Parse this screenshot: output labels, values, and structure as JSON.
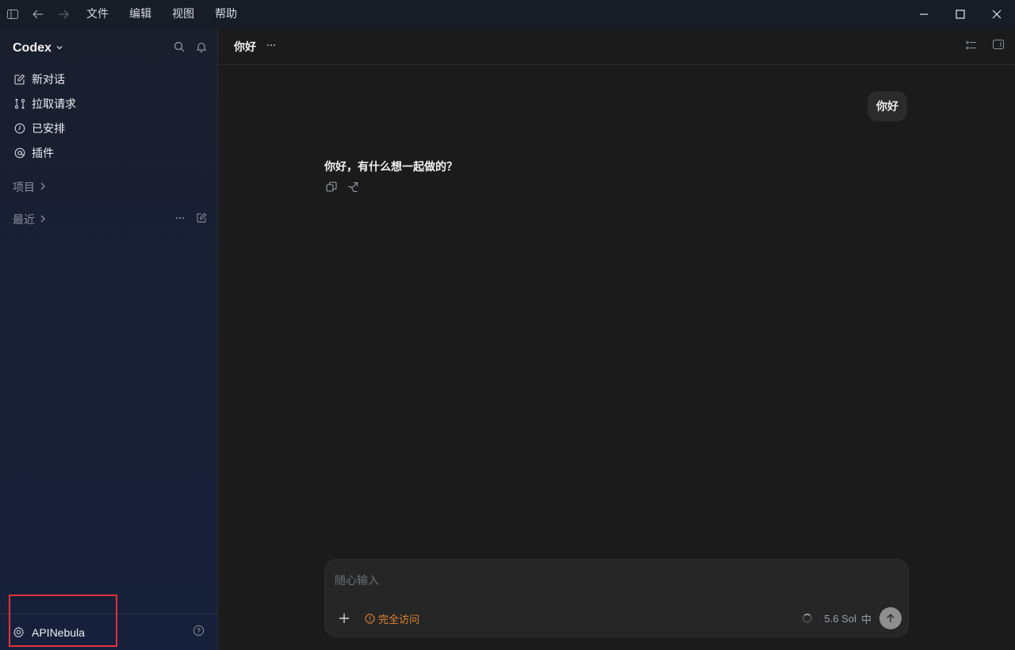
{
  "titlebar": {
    "icons": [
      "sidebar-toggle-icon",
      "back-arrow-icon",
      "forward-arrow-icon"
    ],
    "menu": [
      "文件",
      "编辑",
      "视图",
      "帮助"
    ],
    "window_controls": [
      "minimize-icon",
      "maximize-icon",
      "close-icon"
    ]
  },
  "sidebar": {
    "brand": "Codex",
    "nav": [
      {
        "label": "新对话",
        "icon": "edit-icon"
      },
      {
        "label": "拉取请求",
        "icon": "pull-request-icon"
      },
      {
        "label": "已安排",
        "icon": "clock-icon"
      },
      {
        "label": "插件",
        "icon": "plugin-icon"
      }
    ],
    "projects_label": "项目",
    "recent_label": "最近",
    "footer_label": "APINebula"
  },
  "main": {
    "title": "你好",
    "user_message": "你好",
    "assistant_message": "你好，有什么想一起做的？",
    "composer": {
      "placeholder": "随心输入",
      "access_label": "完全访问",
      "model": "5.6 Sol",
      "effort": "中"
    }
  },
  "colors": {
    "sidebar_bg": "#1a1f2e",
    "main_bg": "#1b1b1b",
    "access_orange": "#e0822f",
    "highlight_red": "#e0333b"
  }
}
